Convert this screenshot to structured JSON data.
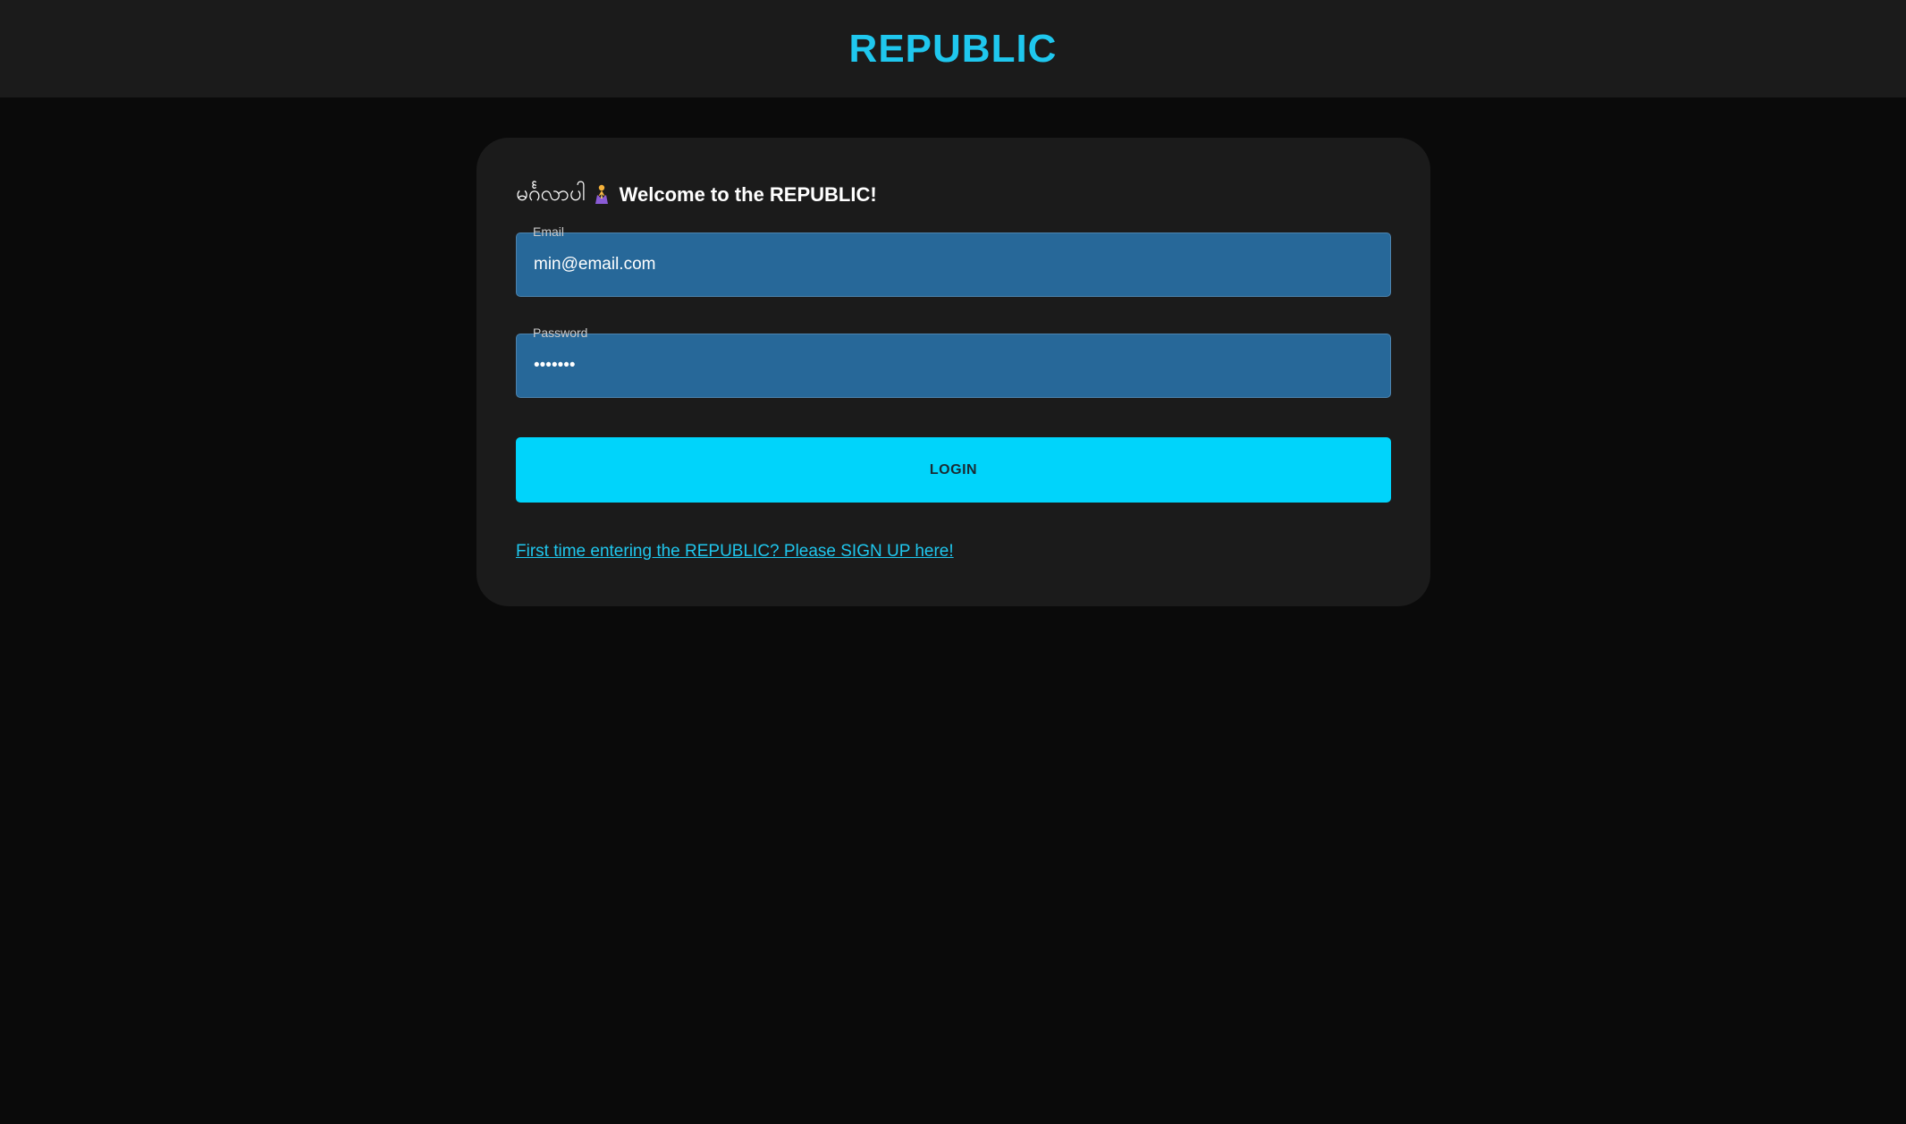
{
  "header": {
    "brand": "REPUBLIC"
  },
  "card": {
    "greeting_native": "မင်္ဂလာပါ",
    "greeting_icon": "folded-hands-icon",
    "greeting_text": "Welcome to the REPUBLIC!",
    "email": {
      "label": "Email",
      "value": "min@email.com"
    },
    "password": {
      "label": "Password",
      "value": "•••••••"
    },
    "login_label": "LOGIN",
    "signup_link": "First time entering the REPUBLIC? Please SIGN UP here!"
  },
  "colors": {
    "accent": "#1fc7ee",
    "button": "#00d4fb",
    "input_bg": "#276899",
    "card_bg": "#1b1b1b",
    "page_bg": "#0a0a0a"
  }
}
